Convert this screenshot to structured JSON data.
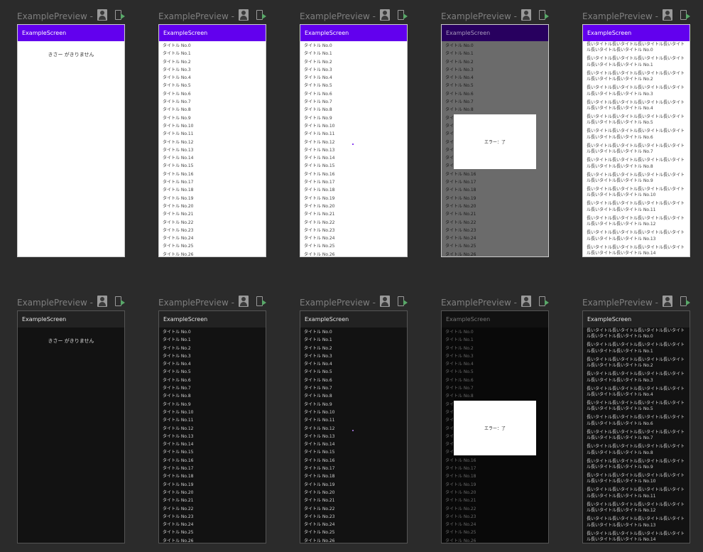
{
  "preview_title": "ExamplePreview - ...",
  "app_bar_title": "ExampleScreen",
  "empty_message": "きさー がきりません",
  "error_message": "エラー：了",
  "short_items": [
    "タイトル No.0",
    "タイトル No.1",
    "タイトル No.2",
    "タイトル No.3",
    "タイトル No.4",
    "タイトル No.5",
    "タイトル No.6",
    "タイトル No.7",
    "タイトル No.8",
    "タイトル No.9",
    "タイトル No.10",
    "タイトル No.11",
    "タイトル No.12",
    "タイトル No.13",
    "タイトル No.14",
    "タイトル No.15",
    "タイトル No.16",
    "タイトル No.17",
    "タイトル No.18",
    "タイトル No.19",
    "タイトル No.20",
    "タイトル No.21",
    "タイトル No.22",
    "タイトル No.23",
    "タイトル No.24",
    "タイトル No.25",
    "タイトル No.26"
  ],
  "long_items": [
    "長いタイトル長いタイトル長いタイトル長いタイトル長いタイトル長いタイトル No.0",
    "長いタイトル長いタイトル長いタイトル長いタイトル長いタイトル長いタイトル No.1",
    "長いタイトル長いタイトル長いタイトル長いタイトル長いタイトル長いタイトル No.2",
    "長いタイトル長いタイトル長いタイトル長いタイトル長いタイトル長いタイトル No.3",
    "長いタイトル長いタイトル長いタイトル長いタイトル長いタイトル長いタイトル No.4",
    "長いタイトル長いタイトル長いタイトル長いタイトル長いタイトル長いタイトル No.5",
    "長いタイトル長いタイトル長いタイトル長いタイトル長いタイトル長いタイトル No.6",
    "長いタイトル長いタイトル長いタイトル長いタイトル長いタイトル長いタイトル No.7",
    "長いタイトル長いタイトル長いタイトル長いタイトル長いタイトル長いタイトル No.8",
    "長いタイトル長いタイトル長いタイトル長いタイトル長いタイトル長いタイトル No.9",
    "長いタイトル長いタイトル長いタイトル長いタイトル長いタイトル長いタイトル No.10",
    "長いタイトル長いタイトル長いタイトル長いタイトル長いタイトル長いタイトル No.11",
    "長いタイトル長いタイトル長いタイトル長いタイトル長いタイトル長いタイトル No.12",
    "長いタイトル長いタイトル長いタイトル長いタイトル長いタイトル長いタイトル No.13",
    "長いタイトル長いタイトル長いタイトル長いタイトル長いタイトル長いタイトル No.14"
  ],
  "colors": {
    "primary_light": "#6200ee",
    "appbar_dark": "#222222",
    "surface_dark": "#121212",
    "background": "#2b2b2b"
  },
  "icons": {
    "interactive_mode": "person-icon",
    "deploy": "deploy-to-device-icon"
  }
}
